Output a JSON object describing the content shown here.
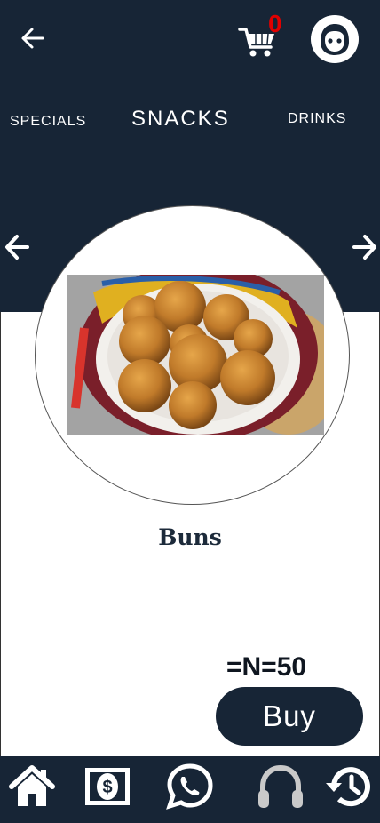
{
  "header": {
    "back_icon": "arrow-left-icon",
    "cart_icon": "cart-icon",
    "cart_count": "0",
    "avatar_icon": "face-avatar-icon"
  },
  "categories": {
    "items": [
      "SPECIALS",
      "SNACKS",
      "DRINKS"
    ],
    "active": "SNACKS"
  },
  "product": {
    "name": "Buns",
    "price": "=N=50",
    "buy_label": "Buy"
  },
  "bottom_nav": {
    "items": [
      "home-icon",
      "money-icon",
      "whatsapp-icon",
      "headphones-icon",
      "history-icon"
    ]
  },
  "colors": {
    "primary": "#172536",
    "badge": "#e00000",
    "background": "#ffffff"
  }
}
